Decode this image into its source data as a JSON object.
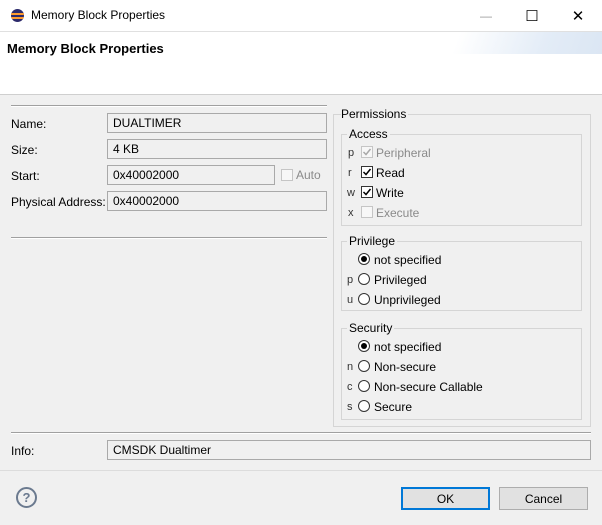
{
  "window": {
    "title": "Memory Block Properties",
    "minimize_glyph": "—",
    "maximize_glyph": "☐",
    "close_glyph": "✕"
  },
  "header": {
    "title": "Memory Block Properties"
  },
  "fields": {
    "name_label": "Name:",
    "name_value": "DUALTIMER",
    "size_label": "Size:",
    "size_value": "4 KB",
    "start_label": "Start:",
    "start_value": "0x40002000",
    "auto_label": "Auto",
    "auto_checked": false,
    "physical_label": "Physical Address:",
    "physical_value": "0x40002000",
    "info_label": "Info:",
    "info_value": "CMSDK Dualtimer"
  },
  "permissions": {
    "title": "Permissions",
    "access": {
      "title": "Access",
      "items": [
        {
          "prefix": "p",
          "label": "Peripheral",
          "checked": true,
          "enabled": false
        },
        {
          "prefix": "r",
          "label": "Read",
          "checked": true,
          "enabled": true
        },
        {
          "prefix": "w",
          "label": "Write",
          "checked": true,
          "enabled": true
        },
        {
          "prefix": "x",
          "label": "Execute",
          "checked": false,
          "enabled": false
        }
      ]
    },
    "privilege": {
      "title": "Privilege",
      "options": [
        {
          "prefix": "",
          "label": "not specified",
          "selected": true
        },
        {
          "prefix": "p",
          "label": "Privileged",
          "selected": false
        },
        {
          "prefix": "u",
          "label": "Unprivileged",
          "selected": false
        }
      ]
    },
    "security": {
      "title": "Security",
      "options": [
        {
          "prefix": "",
          "label": "not specified",
          "selected": true
        },
        {
          "prefix": "n",
          "label": "Non-secure",
          "selected": false
        },
        {
          "prefix": "c",
          "label": "Non-secure Callable",
          "selected": false
        },
        {
          "prefix": "s",
          "label": "Secure",
          "selected": false
        }
      ]
    }
  },
  "footer": {
    "help_glyph": "?",
    "ok_label": "OK",
    "cancel_label": "Cancel"
  },
  "colors": {
    "accent": "#0078d7",
    "field_border": "#a9a9a9",
    "background": "#f0f0f0"
  }
}
